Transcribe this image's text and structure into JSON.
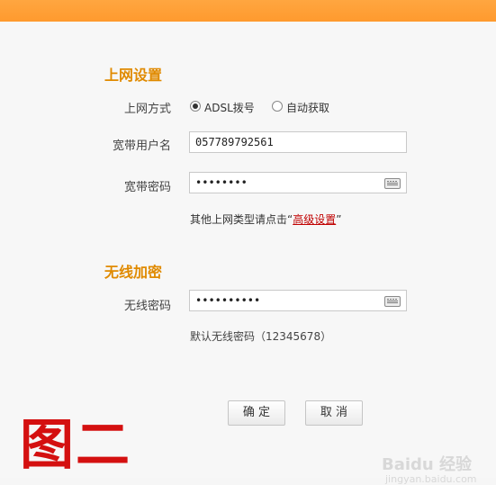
{
  "sections": {
    "internet": {
      "title": "上网设置",
      "method_label": "上网方式",
      "method_options": [
        {
          "label": "ADSL拨号",
          "checked": true
        },
        {
          "label": "自动获取",
          "checked": false
        }
      ],
      "username_label": "宽带用户名",
      "username_value": "057789792561",
      "password_label": "宽带密码",
      "password_value": "••••••••",
      "hint_prefix": "其他上网类型请点击“",
      "hint_link": "高级设置",
      "hint_suffix": "”"
    },
    "wireless": {
      "title": "无线加密",
      "password_label": "无线密码",
      "password_value": "••••••••••",
      "default_hint": "默认无线密码（12345678）"
    }
  },
  "buttons": {
    "confirm": "确 定",
    "cancel": "取 消"
  },
  "annotation": "图二",
  "watermark": {
    "logo": "Baidu 经验",
    "sub": "jingyan.baidu.com"
  },
  "colors": {
    "topbar": "#ff9a2e",
    "section_title": "#e08a00",
    "link": "#c00000",
    "annotation": "#d41010"
  }
}
